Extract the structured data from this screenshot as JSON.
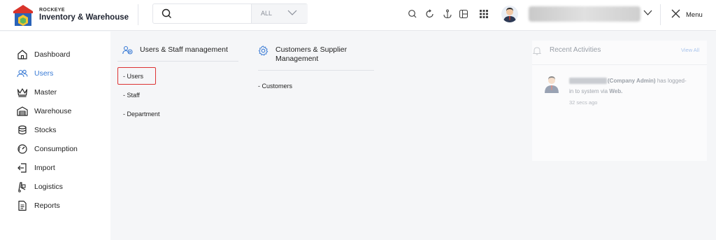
{
  "header": {
    "brand_small": "ROCKEYE",
    "brand_title": "Inventory & Warehouse",
    "search_scope": "ALL",
    "menu_label": "Menu"
  },
  "sidebar": {
    "items": [
      {
        "label": "Dashboard",
        "icon": "home-icon"
      },
      {
        "label": "Users",
        "icon": "users-icon",
        "active": true
      },
      {
        "label": "Master",
        "icon": "crown-icon"
      },
      {
        "label": "Warehouse",
        "icon": "warehouse-icon"
      },
      {
        "label": "Stocks",
        "icon": "stocks-icon"
      },
      {
        "label": "Consumption",
        "icon": "gauge-icon"
      },
      {
        "label": "Import",
        "icon": "import-icon"
      },
      {
        "label": "Logistics",
        "icon": "logistics-icon"
      },
      {
        "label": "Reports",
        "icon": "report-icon"
      }
    ]
  },
  "menu": {
    "users_section": {
      "title": "Users & Staff management",
      "items": [
        "- Users",
        "- Staff",
        "- Department"
      ]
    },
    "customers_section": {
      "title_line1": "Customers & Supplier",
      "title_line2": "Management",
      "items": [
        "- Customers"
      ]
    }
  },
  "activity": {
    "title": "Recent Activities",
    "view_all": "View All",
    "entry": {
      "role": "(Company Admin)",
      "text_after_role": " has logged-",
      "line2_prefix": "in to system via ",
      "line2_channel": "Web.",
      "time": "32 secs ago"
    }
  },
  "colors": {
    "accent": "#3a7bd5",
    "highlight_border": "#dd3333"
  }
}
